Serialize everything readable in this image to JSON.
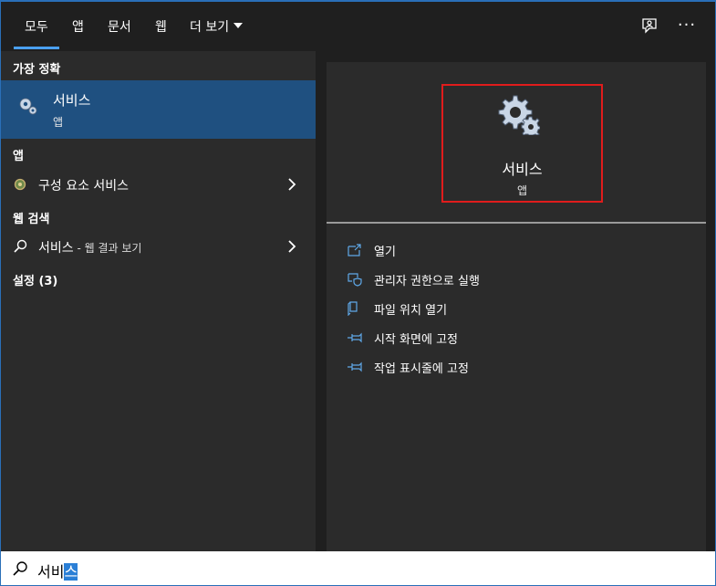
{
  "tabs": [
    {
      "label": "모두",
      "active": true
    },
    {
      "label": "앱"
    },
    {
      "label": "문서"
    },
    {
      "label": "웹"
    },
    {
      "label": "더 보기"
    }
  ],
  "top_icons": [
    "feedback-icon",
    "more-icon"
  ],
  "left": {
    "best_match_title": "가장 정확",
    "best_match": {
      "name": "서비스",
      "type": "앱",
      "icon": "gear-icon"
    },
    "apps_title": "앱",
    "apps": [
      {
        "label": "구성 요소 서비스",
        "icon": "component-services-icon"
      }
    ],
    "web_title": "웹 검색",
    "web_item": {
      "label": "서비스",
      "suffix": " - 웹 결과 보기",
      "icon": "search-icon"
    },
    "settings_title": "설정 (3)"
  },
  "preview": {
    "name": "서비스",
    "type": "앱",
    "actions": [
      {
        "label": "열기",
        "icon": "open-icon"
      },
      {
        "label": "관리자 권한으로 실행",
        "icon": "admin-shield-icon"
      },
      {
        "label": "파일 위치 열기",
        "icon": "file-location-icon"
      },
      {
        "label": "시작 화면에 고정",
        "icon": "pin-icon"
      },
      {
        "label": "작업 표시줄에 고정",
        "icon": "pin-icon"
      }
    ]
  },
  "search": {
    "typed": "서비",
    "composing": "스"
  },
  "colors": {
    "accent": "#1f5080",
    "highlight_border": "#e01c1c",
    "tab_underline": "#4aa0f0"
  }
}
